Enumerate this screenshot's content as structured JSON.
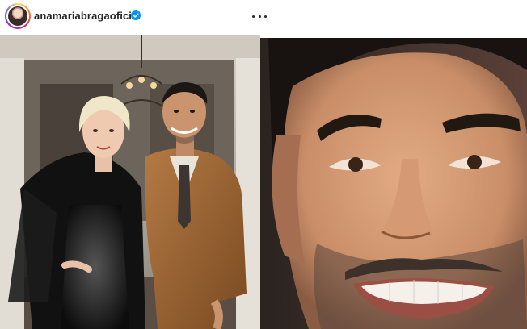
{
  "post": {
    "username": "anamariabragaoficial",
    "verified": true,
    "icons": {
      "avatar": "profile-avatar",
      "verified": "verified-badge-icon",
      "more": "more-options-icon"
    },
    "colors": {
      "verified_blue": "#0095f6",
      "text": "#262626"
    },
    "media": {
      "left_image": "couple-photo",
      "right_image": "face-closeup-photo"
    }
  }
}
